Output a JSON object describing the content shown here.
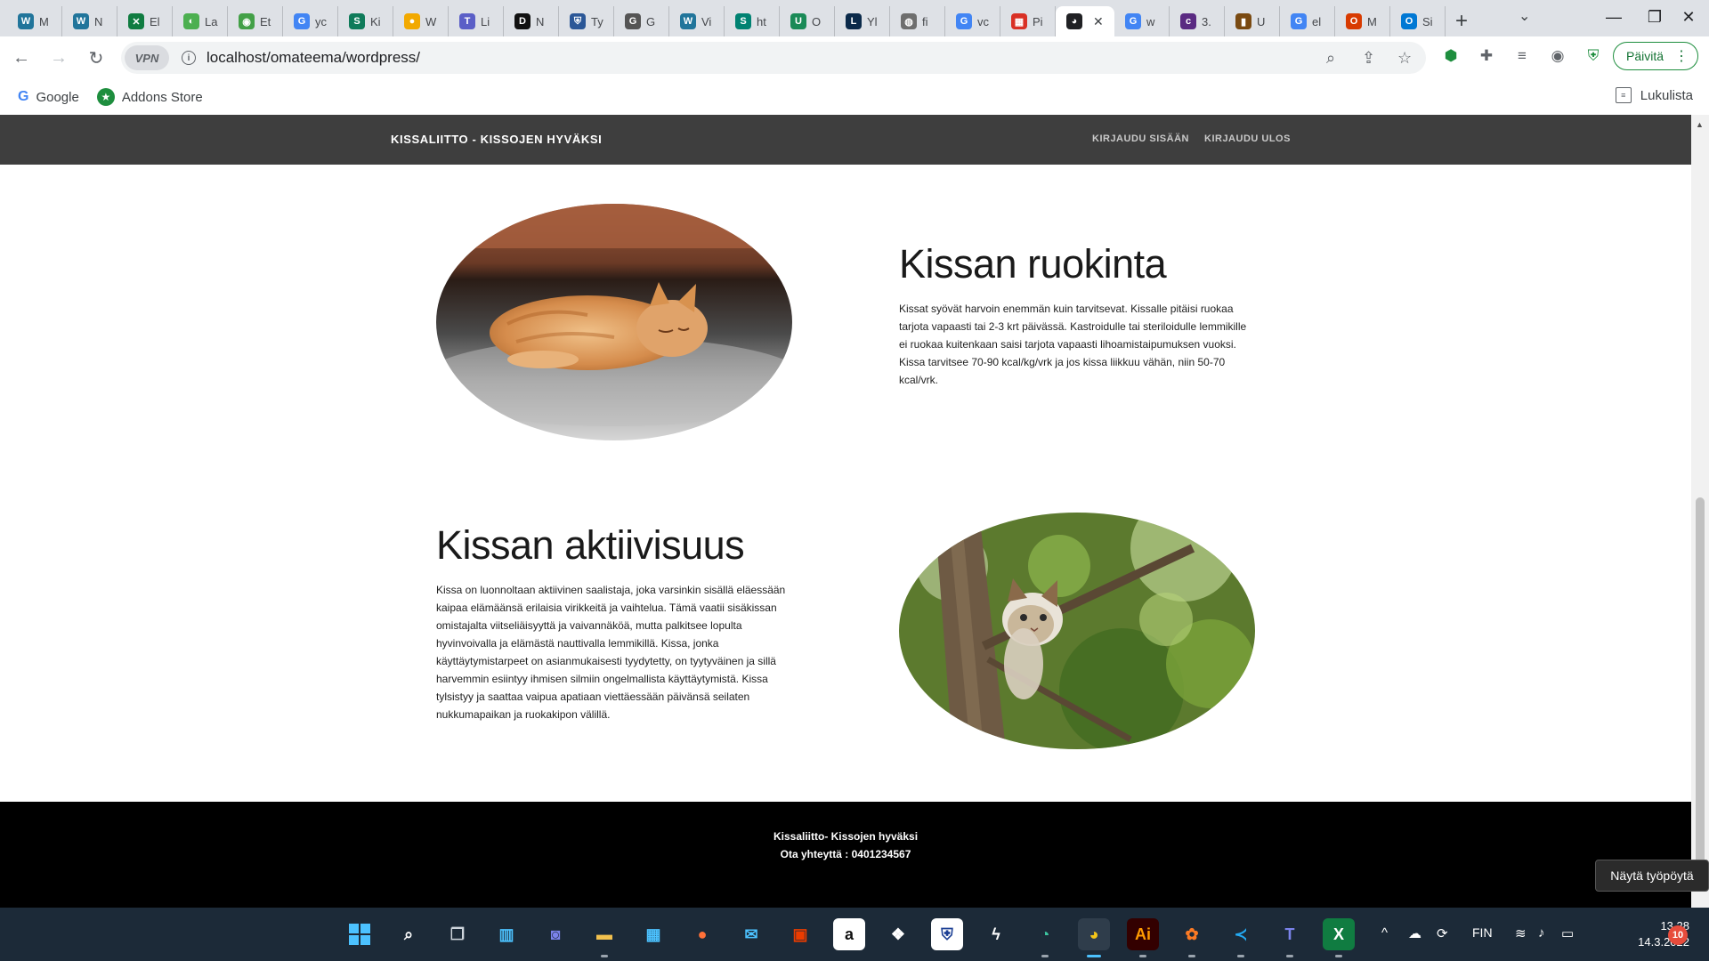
{
  "tabs": [
    {
      "short": "M",
      "icon": "W",
      "color": "#21759b"
    },
    {
      "short": "N",
      "icon": "W",
      "color": "#21759b"
    },
    {
      "short": "El",
      "icon": "✕",
      "color": "#107c41"
    },
    {
      "short": "La",
      "icon": "◐",
      "color": "#4caf50"
    },
    {
      "short": "Et",
      "icon": "◉",
      "color": "#43a047"
    },
    {
      "short": "yc",
      "icon": "G",
      "color": "#4285f4"
    },
    {
      "short": "Ki",
      "icon": "S",
      "color": "#0f7b5a"
    },
    {
      "short": "W",
      "icon": "●",
      "color": "#f2a900"
    },
    {
      "short": "Li",
      "icon": "T",
      "color": "#5b5fc7"
    },
    {
      "short": "N",
      "icon": "D",
      "color": "#111111"
    },
    {
      "short": "Ty",
      "icon": "⛨",
      "color": "#2b5797"
    },
    {
      "short": "G",
      "icon": "G",
      "color": "#555555"
    },
    {
      "short": "Vi",
      "icon": "W",
      "color": "#21759b"
    },
    {
      "short": "ht",
      "icon": "S",
      "color": "#008272"
    },
    {
      "short": "O",
      "icon": "U",
      "color": "#1a8a57"
    },
    {
      "short": "Yl",
      "icon": "L",
      "color": "#0b2a4a"
    },
    {
      "short": "fi",
      "icon": "◍",
      "color": "#6e6e6e"
    },
    {
      "short": "vc",
      "icon": "G",
      "color": "#4285f4"
    },
    {
      "short": "Pi",
      "icon": "▦",
      "color": "#d93025"
    },
    {
      "short": "",
      "icon": "◕",
      "color": "#202124",
      "active": true
    },
    {
      "short": "w",
      "icon": "G",
      "color": "#4285f4"
    },
    {
      "short": "3.",
      "icon": "c",
      "color": "#5a2a82"
    },
    {
      "short": "U",
      "icon": "▮",
      "color": "#7a4a12"
    },
    {
      "short": "el",
      "icon": "G",
      "color": "#4285f4"
    },
    {
      "short": "M",
      "icon": "O",
      "color": "#d83b01"
    },
    {
      "short": "Si",
      "icon": "O",
      "color": "#0078d4"
    }
  ],
  "browser": {
    "url": "localhost/omateema/wordpress/",
    "vpn_label": "VPN",
    "update_label": "Päivitä",
    "bookmarks": [
      {
        "label": "Google",
        "icon": "G"
      },
      {
        "label": "Addons Store",
        "icon": "★"
      }
    ],
    "reading_list": "Lukulista"
  },
  "site": {
    "title": "KISSALIITTO - KISSOJEN HYVÄKSI",
    "nav": [
      "KIRJAUDU SISÄÄN",
      "KIRJAUDU ULOS"
    ],
    "sections": [
      {
        "title": "Kissan ruokinta",
        "body": "Kissat syövät harvoin enemmän kuin tarvitsevat. Kissalle pitäisi ruokaa tarjota vapaasti tai 2-3 krt päivässä. Kastroidulle tai steriloidulle lemmikille ei ruokaa kuitenkaan saisi tarjota vapaasti lihoamistaipumuksen vuoksi. Kissa tarvitsee 70-90 kcal/kg/vrk ja jos kissa liikkuu vähän, niin 50-70 kcal/vrk."
      },
      {
        "title": "Kissan aktiivisuus",
        "body": "Kissa on luonnoltaan aktiivinen saalistaja, joka varsinkin sisällä eläessään kaipaa elämäänsä erilaisia virikkeitä ja vaihtelua. Tämä vaatii sisäkissan omistajalta viitseliäisyyttä ja vaivannäköä, mutta palkitsee lopulta hyvinvoivalla ja elämästä nauttivalla lemmikillä. Kissa, jonka käyttäytymistarpeet on asianmukaisesti tyydytetty, on tyytyväinen ja sillä harvemmin esiintyy ihmisen silmiin ongelmallista käyttäytymistä. Kissa tylsistyy ja saattaa vaipua apatiaan viettäessään päivänsä seilaten nukkumapaikan ja ruokakipon välillä."
      }
    ],
    "footer_line1": "Kissaliitto- Kissojen hyväksi",
    "footer_line2": "Ota yhteyttä : 0401234567"
  },
  "tooltip": "Näytä työpöytä",
  "taskbar": {
    "language": "FIN",
    "time": "13.28",
    "date": "14.3.2022",
    "notifications": "10"
  }
}
